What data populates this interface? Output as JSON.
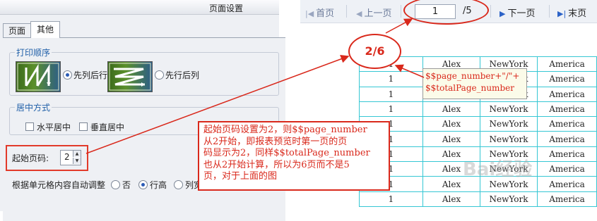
{
  "dialog": {
    "title": "页面设置",
    "tabs": [
      {
        "label": "页面"
      },
      {
        "label": "其他"
      }
    ],
    "print_order": {
      "group_title": "打印顺序",
      "option_col_first": "先列后行",
      "option_row_first": "先行后列"
    },
    "center": {
      "group_title": "居中方式",
      "horizontal": "水平居中",
      "vertical": "垂直居中"
    },
    "start_page": {
      "label": "起始页码:",
      "value": "2"
    },
    "auto_adjust": {
      "label": "根据单元格内容自动调整",
      "option_no": "否",
      "option_row_height": "行高",
      "option_col_width": "列宽"
    }
  },
  "pager": {
    "first": "首页",
    "prev": "上一页",
    "current_page": "1",
    "total": "/5",
    "next": "下一页",
    "last": "末页"
  },
  "report": {
    "rows": [
      [
        "1",
        "Alex",
        "NewYork",
        "America"
      ],
      [
        "1",
        "Alex",
        "NewYork",
        "America"
      ],
      [
        "1",
        "Alex",
        "NewYork",
        "America"
      ],
      [
        "1",
        "Alex",
        "NewYork",
        "America"
      ],
      [
        "1",
        "Alex",
        "NewYork",
        "America"
      ],
      [
        "1",
        "Alex",
        "NewYork",
        "America"
      ],
      [
        "1",
        "Alex",
        "NewYork",
        "America"
      ],
      [
        "1",
        "Alex",
        "NewYork",
        "America"
      ],
      [
        "1",
        "Alex",
        "NewYork",
        "America"
      ],
      [
        "1",
        "Alex",
        "NewYork",
        "America"
      ]
    ]
  },
  "annotations": {
    "page_number_display": "2/6",
    "formula_line1": "$$page_number+\"/\"+",
    "formula_line2": "$$totalPage_number",
    "explain_lines": [
      "起始页码设置为2，则$$page_number",
      "从2开始，即报表预览时第一页的页",
      "码显示为2，同样$$totalPage_number",
      "也从2开始计算，所以为6页而不是5",
      "页，对于上面的图"
    ],
    "watermark": "Bai经验"
  },
  "colors": {
    "annotation_red": "#d9281b",
    "table_border": "#36c7d4",
    "dialog_bg": "#eef0f4"
  }
}
